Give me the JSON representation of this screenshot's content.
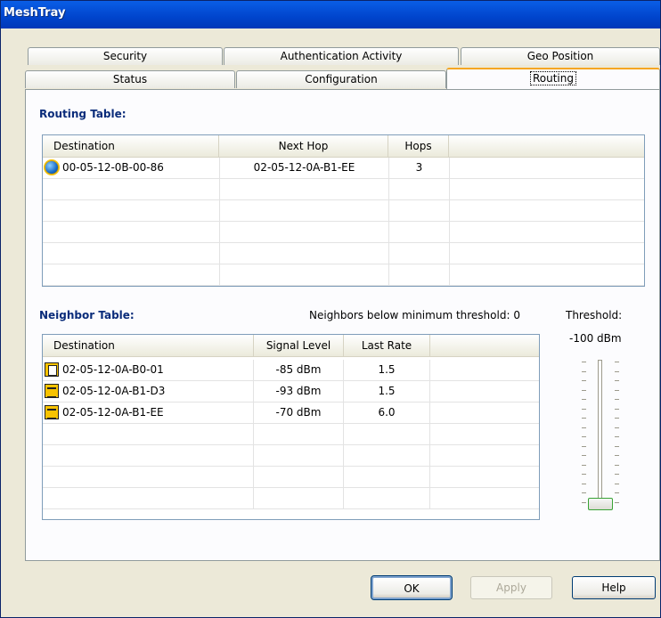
{
  "window": {
    "title": "MeshTray"
  },
  "tabs": {
    "back_row": [
      "Security",
      "Authentication Activity",
      "Geo Position"
    ],
    "front_row": [
      "Status",
      "Configuration",
      "Routing"
    ],
    "active": "Routing"
  },
  "routing": {
    "heading": "Routing Table:",
    "columns": [
      "Destination",
      "Next Hop",
      "Hops"
    ],
    "rows": [
      {
        "icon": "globe-icon",
        "destination": "00-05-12-0B-00-86",
        "next_hop": "02-05-12-0A-B1-EE",
        "hops": "3"
      }
    ]
  },
  "neighbor": {
    "heading": "Neighbor Table:",
    "below_threshold": "Neighbors below minimum threshold: 0",
    "columns": [
      "Destination",
      "Signal Level",
      "Last Rate"
    ],
    "rows": [
      {
        "icon": "node-icon",
        "destination": "02-05-12-0A-B0-01",
        "signal": "-85 dBm",
        "rate": "1.5"
      },
      {
        "icon": "mesh-icon",
        "destination": "02-05-12-0A-B1-D3",
        "signal": "-93 dBm",
        "rate": "1.5"
      },
      {
        "icon": "mesh-icon",
        "destination": "02-05-12-0A-B1-EE",
        "signal": "-70 dBm",
        "rate": "6.0"
      }
    ]
  },
  "threshold": {
    "label": "Threshold:",
    "value": "-100 dBm",
    "slider_fraction": 0
  },
  "buttons": {
    "ok": "OK",
    "apply": "Apply",
    "help": "Help"
  },
  "colors": {
    "title_bar": "#0054e3",
    "accent": "#f5a623",
    "heading": "#0a2c7a"
  }
}
